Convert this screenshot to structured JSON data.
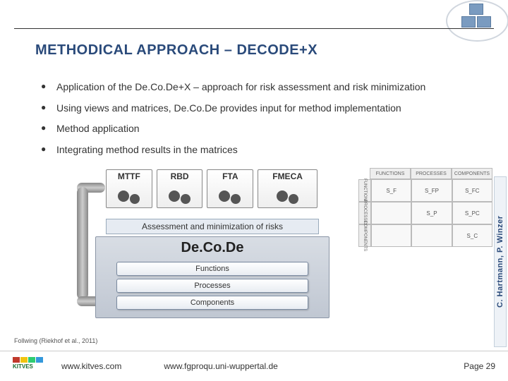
{
  "title": "METHODICAL APPROACH – DECODE+X",
  "bullets": [
    "Application of the De.Co.De+X – approach for risk assessment and risk minimization",
    "Using views and matrices, De.Co.De provides input for method implementation",
    "Method application",
    "Integrating method results in the matrices"
  ],
  "methods": {
    "m0": "MTTF",
    "m1": "RBD",
    "m2": "FTA",
    "m3": "FMECA"
  },
  "assess_label": "Assessment and minimization of risks",
  "decode": {
    "label": "De.Co.De",
    "layers": {
      "l0": "Functions",
      "l1": "Processes",
      "l2": "Components"
    }
  },
  "matrix": {
    "col_headers": {
      "c0": "FUNCTIONS",
      "c1": "PROCESSES",
      "c2": "COMPONENTS"
    },
    "row_headers": {
      "r0": "FUNCTIONS",
      "r1": "PROCESSES",
      "r2": "COMPONENTS"
    },
    "cells": {
      "r0c0": "S_F",
      "r0c1": "S_FP",
      "r0c2": "S_FC",
      "r1c0": "",
      "r1c1": "S_P",
      "r1c2": "S_PC",
      "r2c0": "",
      "r2c1": "",
      "r2c2": "S_C"
    }
  },
  "credit_vertical": "C. Hartmann, P. Winzer",
  "citation": "Follwing (Riekhof  et al., 2011)",
  "footer": {
    "url1": "www.kitves.com",
    "url2": "www.fgproqu.uni-wuppertal.de",
    "page": "Page 29",
    "logo_name": "KITVES"
  }
}
